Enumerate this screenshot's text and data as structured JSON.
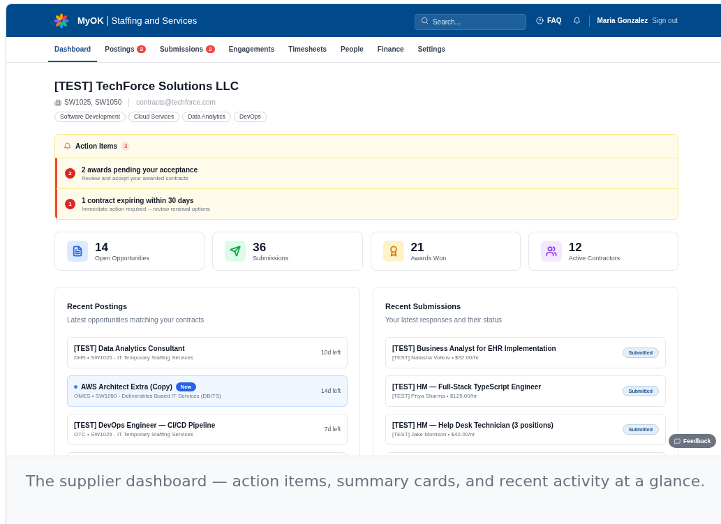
{
  "header": {
    "brand": "MyOK",
    "app_name": "Staffing and Services",
    "search": {
      "placeholder": "Search..."
    },
    "faq": "FAQ",
    "user": "Maria Gonzalez",
    "sign_out": "Sign out"
  },
  "nav": [
    {
      "label": "Dashboard",
      "selected": true
    },
    {
      "label": "Postings",
      "selected": false,
      "count": "3"
    },
    {
      "label": "Submissions",
      "selected": false,
      "count": "2"
    },
    {
      "label": "Engagements",
      "selected": false
    },
    {
      "label": "Timesheets",
      "selected": false
    },
    {
      "label": "People",
      "selected": false
    },
    {
      "label": "Finance",
      "selected": false
    },
    {
      "label": "Settings",
      "selected": false
    }
  ],
  "company": {
    "name": "[TEST] TechForce Solutions LLC",
    "contracts": "SW1025, SW1050",
    "email": "contracts@techforce.com",
    "tags": [
      "Software Development",
      "Cloud Services",
      "Data Analytics",
      "DevOps"
    ]
  },
  "action_items": {
    "title": "Action Items",
    "count": "3",
    "items": [
      {
        "count": "2",
        "title": "2 awards pending your acceptance",
        "detail": "Review and accept your awarded contracts"
      },
      {
        "count": "1",
        "title": "1 contract expiring within 30 days",
        "detail": "Immediate action required -- review renewal options"
      }
    ]
  },
  "stats": [
    {
      "kind": "document",
      "value": "14",
      "label": "Open Opportunities",
      "color": "#2563eb"
    },
    {
      "kind": "send",
      "value": "36",
      "label": "Submissions",
      "color": "#16a34a"
    },
    {
      "kind": "award",
      "value": "21",
      "label": "Awards Won",
      "color": "#d97706"
    },
    {
      "kind": "users",
      "value": "12",
      "label": "Active Contractors",
      "color": "#9333ea"
    }
  ],
  "recent_postings": {
    "title": "Recent Postings",
    "subtitle": "Latest opportunities matching your contracts",
    "rows": [
      {
        "title": "[TEST] Data Analytics Consultant",
        "meta": "DHS • SW1025 - IT Temporary Staffing Services",
        "time_left": "10d left",
        "unread": false
      },
      {
        "title": "AWS Architect Extra (Copy)",
        "badge": "New",
        "meta": "OMES • SW1050 - Deliverables Based IT Services (DBITS)",
        "time_left": "14d left",
        "unread": true
      },
      {
        "title": "[TEST] DevOps Engineer — CI/CD Pipeline",
        "meta": "OTC • SW1025 - IT Temporary Staffing Services",
        "time_left": "7d left",
        "unread": false
      }
    ]
  },
  "recent_submissions": {
    "title": "Recent Submissions",
    "subtitle": "Your latest responses and their status",
    "rows": [
      {
        "title": "[TEST] Business Analyst for EHR Implementation",
        "meta": "[TEST] Natasha Volkov • $92.00/hr",
        "status": "Submitted"
      },
      {
        "title": "[TEST] HM — Full-Stack TypeScript Engineer",
        "meta": "[TEST] Priya Sharma • $125.00/hr",
        "status": "Submitted"
      },
      {
        "title": "[TEST] HM — Help Desk Technician (3 positions)",
        "meta": "[TEST] Jake Morrison • $42.00/hr",
        "status": "Submitted"
      }
    ]
  },
  "feedback_button": "Feedback",
  "caption": "The supplier dashboard — action items, summary cards, and recent activity at a glance."
}
